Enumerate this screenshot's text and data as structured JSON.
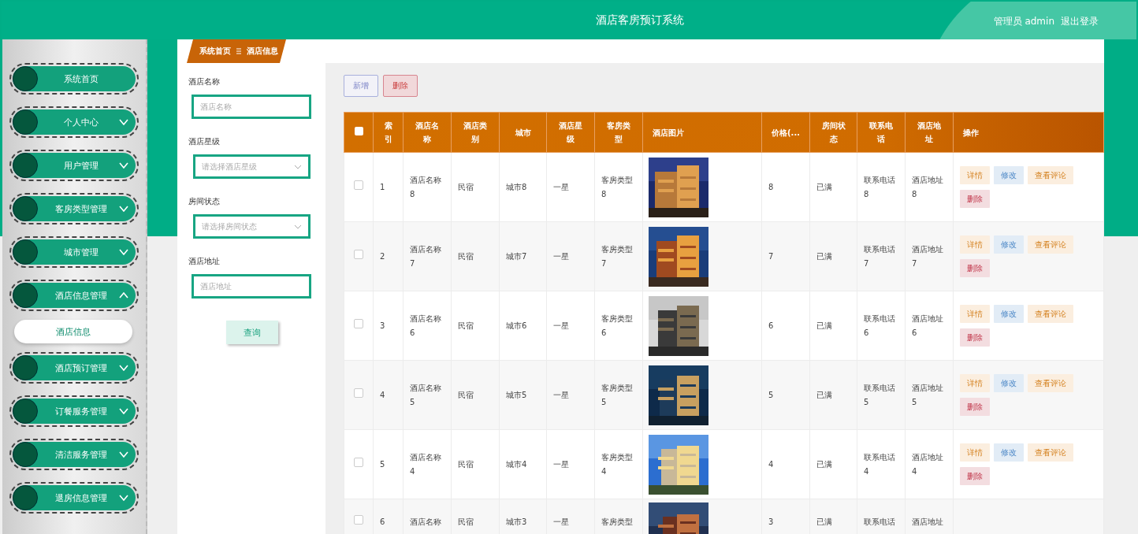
{
  "header": {
    "title": "酒店客房预订系统",
    "user": "管理员 admin",
    "logout": "退出登录"
  },
  "sidebar": {
    "items": [
      {
        "label": "系统首页",
        "kind": "link"
      },
      {
        "label": "个人中心",
        "kind": "menu",
        "expanded": false
      },
      {
        "label": "用户管理",
        "kind": "menu",
        "expanded": false
      },
      {
        "label": "客房类型管理",
        "kind": "menu",
        "expanded": false
      },
      {
        "label": "城市管理",
        "kind": "menu",
        "expanded": false
      },
      {
        "label": "酒店信息管理",
        "kind": "menu",
        "expanded": true,
        "children": [
          {
            "label": "酒店信息",
            "selected": true
          }
        ]
      },
      {
        "label": "酒店预订管理",
        "kind": "menu",
        "expanded": false
      },
      {
        "label": "订餐服务管理",
        "kind": "menu",
        "expanded": false
      },
      {
        "label": "清洁服务管理",
        "kind": "menu",
        "expanded": false
      },
      {
        "label": "退房信息管理",
        "kind": "menu",
        "expanded": false
      }
    ]
  },
  "breadcrumb": [
    "系统首页",
    "酒店信息"
  ],
  "search": {
    "fields": [
      {
        "label": "酒店名称",
        "kind": "text",
        "placeholder": "酒店名称"
      },
      {
        "label": "酒店星级",
        "kind": "select",
        "placeholder": "请选择酒店星级"
      },
      {
        "label": "房间状态",
        "kind": "select",
        "placeholder": "请选择房间状态"
      },
      {
        "label": "酒店地址",
        "kind": "text",
        "placeholder": "酒店地址"
      }
    ],
    "button": "查询"
  },
  "toolbar": [
    {
      "label": "新增",
      "kind": "add"
    },
    {
      "label": "删除",
      "kind": "delete"
    }
  ],
  "table": {
    "select_all": {
      "checked": false
    },
    "columns": [
      "索引",
      "酒店名称",
      "酒店类别",
      "城市",
      "酒店星级",
      "客房类型",
      "酒店图片",
      "价格(...",
      "房间状态",
      "联系电话",
      "酒店地址",
      "操作"
    ],
    "rows": [
      {
        "checked": false,
        "index": "1",
        "name": "酒店名称8",
        "category": "民宿",
        "city": "城市8",
        "stars": "一星",
        "room_type": "客房类型8",
        "price": "8",
        "status": "已满",
        "phone": "联系电话8",
        "address": "酒店地址8",
        "actions": [
          {
            "label": "详情",
            "kind": "detail"
          },
          {
            "label": "修改",
            "kind": "edit"
          },
          {
            "label": "查看评论",
            "kind": "comments"
          },
          {
            "label": "删除",
            "kind": "delete"
          }
        ]
      },
      {
        "checked": false,
        "index": "2",
        "name": "酒店名称7",
        "category": "民宿",
        "city": "城市7",
        "stars": "一星",
        "room_type": "客房类型7",
        "price": "7",
        "status": "已满",
        "phone": "联系电话7",
        "address": "酒店地址7",
        "actions": [
          {
            "label": "详情",
            "kind": "detail"
          },
          {
            "label": "修改",
            "kind": "edit"
          },
          {
            "label": "查看评论",
            "kind": "comments"
          },
          {
            "label": "删除",
            "kind": "delete"
          }
        ]
      },
      {
        "checked": false,
        "index": "3",
        "name": "酒店名称6",
        "category": "民宿",
        "city": "城市6",
        "stars": "一星",
        "room_type": "客房类型6",
        "price": "6",
        "status": "已满",
        "phone": "联系电话6",
        "address": "酒店地址6",
        "actions": [
          {
            "label": "详情",
            "kind": "detail"
          },
          {
            "label": "修改",
            "kind": "edit"
          },
          {
            "label": "查看评论",
            "kind": "comments"
          },
          {
            "label": "删除",
            "kind": "delete"
          }
        ]
      },
      {
        "checked": false,
        "index": "4",
        "name": "酒店名称5",
        "category": "民宿",
        "city": "城市5",
        "stars": "一星",
        "room_type": "客房类型5",
        "price": "5",
        "status": "已满",
        "phone": "联系电话5",
        "address": "酒店地址5",
        "actions": [
          {
            "label": "详情",
            "kind": "detail"
          },
          {
            "label": "修改",
            "kind": "edit"
          },
          {
            "label": "查看评论",
            "kind": "comments"
          },
          {
            "label": "删除",
            "kind": "delete"
          }
        ]
      },
      {
        "checked": false,
        "index": "5",
        "name": "酒店名称4",
        "category": "民宿",
        "city": "城市4",
        "stars": "一星",
        "room_type": "客房类型4",
        "price": "4",
        "status": "已满",
        "phone": "联系电话4",
        "address": "酒店地址4",
        "actions": [
          {
            "label": "详情",
            "kind": "detail"
          },
          {
            "label": "修改",
            "kind": "edit"
          },
          {
            "label": "查看评论",
            "kind": "comments"
          },
          {
            "label": "删除",
            "kind": "delete"
          }
        ]
      },
      {
        "checked": false,
        "index": "6",
        "name": "酒店名称",
        "category": "民宿",
        "city": "城市3",
        "stars": "一星",
        "room_type": "客房类型",
        "price": "3",
        "status": "已满",
        "phone": "联系电话",
        "address": "酒店地址"
      }
    ]
  }
}
